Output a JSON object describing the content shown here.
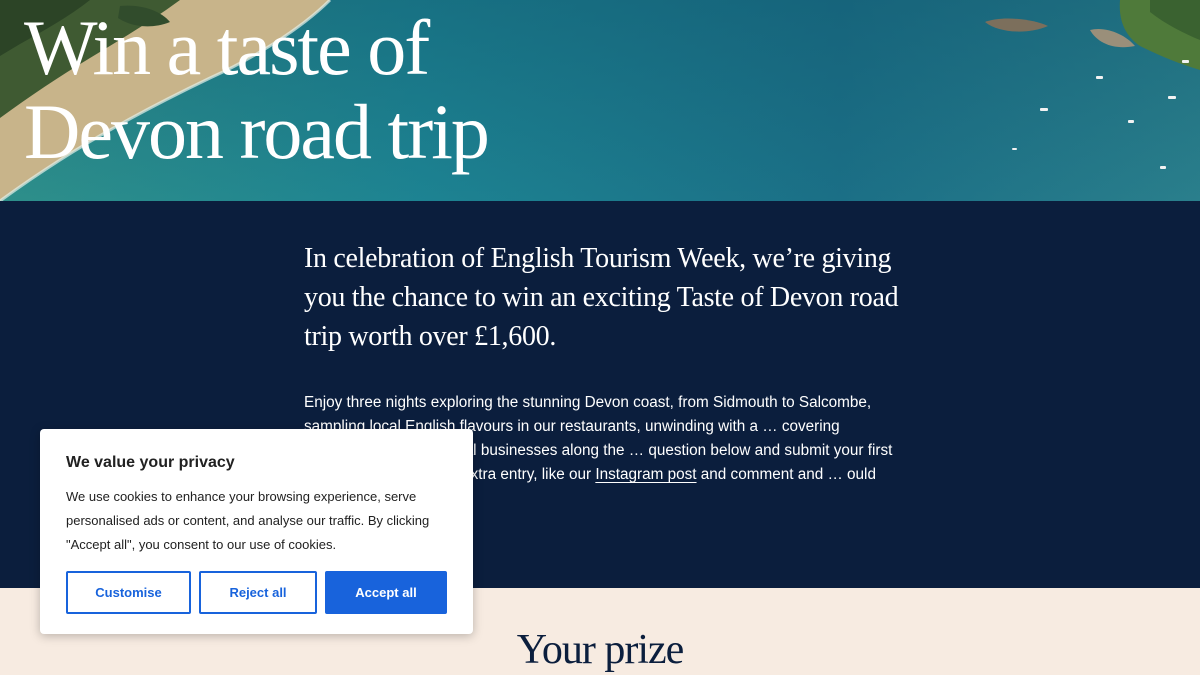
{
  "hero": {
    "title_line1": "Win a taste of",
    "title_line2": "Devon road trip"
  },
  "intro": {
    "lead": "In celebration of English Tourism Week, we’re giving you the chance to win an exciting Taste of Devon road trip worth over £1,600.",
    "body_part1": "Enjoy three nights exploring the stunning Devon coast, from Sidmouth to Salcombe, sampling local English flavours in our restaurants, unwinding with a … covering delicious treats from local businesses along the … question below and submit your first name, last name … an extra entry, like our ",
    "body_link": "Instagram post",
    "body_part2": " and comment and … ould like to share this with."
  },
  "prize": {
    "heading": "Your prize"
  },
  "cookie_banner": {
    "title": "We value your privacy",
    "text": "We use cookies to enhance your browsing experience, serve personalised ads or content, and analyse our traffic. By clicking \"Accept all\", you consent to our use of cookies.",
    "customise_label": "Customise",
    "reject_label": "Reject all",
    "accept_label": "Accept all"
  },
  "colors": {
    "navy": "#0b1e3d",
    "cream": "#f7ebe1",
    "accent_blue": "#1863dc"
  }
}
